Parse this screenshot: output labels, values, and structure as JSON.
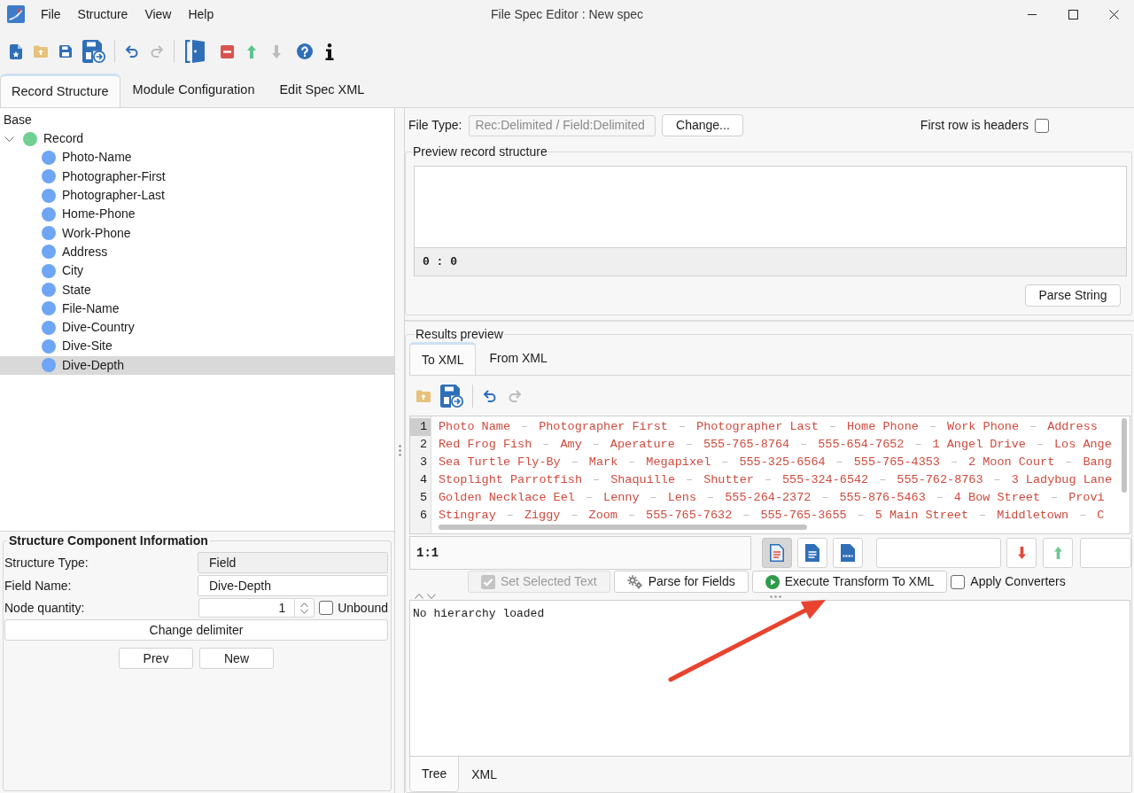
{
  "window": {
    "title": "File Spec Editor : New spec",
    "menu": [
      "File",
      "Structure",
      "View",
      "Help"
    ]
  },
  "toolbar": [
    {
      "divider": true,
      "items": [
        {
          "kind": "new",
          "disabled": false
        },
        {
          "kind": "open",
          "disabled": false
        },
        {
          "kind": "save",
          "disabled": false
        },
        {
          "kind": "save_as",
          "disabled": false
        }
      ]
    },
    {
      "divider": true,
      "items": [
        {
          "kind": "undo",
          "disabled": false
        },
        {
          "kind": "redo",
          "disabled": true
        }
      ]
    },
    {
      "divider": false,
      "items": [
        {
          "kind": "exit",
          "disabled": false
        }
      ]
    },
    {
      "divider": false,
      "items": [
        {
          "kind": "remove",
          "disabled": false
        },
        {
          "kind": "move_up",
          "disabled": false
        },
        {
          "kind": "move_down",
          "disabled": true
        }
      ]
    },
    {
      "divider": false,
      "items": [
        {
          "kind": "help",
          "disabled": false
        },
        {
          "kind": "info",
          "disabled": false
        }
      ]
    }
  ],
  "tabs": [
    {
      "label": "Record Structure",
      "selected": true
    },
    {
      "label": "Module Configuration",
      "selected": false
    },
    {
      "label": "Edit Spec XML",
      "selected": false
    }
  ],
  "tree": {
    "heading": "Base",
    "nodes": [
      {
        "label": "Record",
        "kind": "record",
        "expanded": true,
        "selected": false,
        "children": [
          {
            "label": "Photo-Name",
            "kind": "field",
            "selected": false
          },
          {
            "label": "Photographer-First",
            "kind": "field",
            "selected": false
          },
          {
            "label": "Photographer-Last",
            "kind": "field",
            "selected": false
          },
          {
            "label": "Home-Phone",
            "kind": "field",
            "selected": false
          },
          {
            "label": "Work-Phone",
            "kind": "field",
            "selected": false
          },
          {
            "label": "Address",
            "kind": "field",
            "selected": false
          },
          {
            "label": "City",
            "kind": "field",
            "selected": false
          },
          {
            "label": "State",
            "kind": "field",
            "selected": false
          },
          {
            "label": "File-Name",
            "kind": "field",
            "selected": false
          },
          {
            "label": "Dive-Country",
            "kind": "field",
            "selected": false
          },
          {
            "label": "Dive-Site",
            "kind": "field",
            "selected": false
          },
          {
            "label": "Dive-Depth",
            "kind": "field",
            "selected": true
          }
        ]
      }
    ]
  },
  "component_info": {
    "title": "Structure Component Information",
    "rows": [
      {
        "label": "Structure Type:",
        "kind": "readonly",
        "value": "Field"
      },
      {
        "label": "Field Name:",
        "kind": "text",
        "value": "Dive-Depth"
      },
      {
        "label": "Node quantity:",
        "kind": "spinner",
        "value": "1",
        "option": {
          "label": "Unbound",
          "checked": false
        }
      }
    ],
    "wide_button": "Change delimiter",
    "buttons": [
      "Prev",
      "New"
    ]
  },
  "file_type": {
    "label": "File Type:",
    "value": "Rec:Delimited / Field:Delimited",
    "disabled": true,
    "button": "Change...",
    "headers_option": {
      "label": "First row is headers",
      "checked": false
    }
  },
  "preview": {
    "title": "Preview record structure",
    "position": "0 : 0",
    "button": "Parse String"
  },
  "results": {
    "title": "Results preview",
    "tabs": [
      {
        "label": "To XML",
        "selected": true
      },
      {
        "label": "From XML",
        "selected": false
      }
    ],
    "toolbar": [
      {
        "divider": true,
        "items": [
          {
            "kind": "open",
            "disabled": false
          },
          {
            "kind": "save_as",
            "disabled": false
          }
        ]
      },
      {
        "divider": false,
        "items": [
          {
            "kind": "undo",
            "disabled": false
          },
          {
            "kind": "redo",
            "disabled": true
          }
        ]
      }
    ],
    "editor": {
      "separator": "–",
      "lines": [
        {
          "number": "1",
          "current": true,
          "fields": [
            "Photo Name",
            "Photographer First",
            "Photographer Last",
            "Home Phone",
            "Work Phone",
            "Address"
          ]
        },
        {
          "number": "2",
          "current": false,
          "fields": [
            "Red Frog Fish",
            "Amy",
            "Aperature",
            "555-765-8764",
            "555-654-7652",
            "1 Angel Drive",
            "Los Ange"
          ]
        },
        {
          "number": "3",
          "current": false,
          "fields": [
            "Sea Turtle Fly-By",
            "Mark",
            "Megapixel",
            "555-325-6564",
            "555-765-4353",
            "2 Moon Court",
            "Bang"
          ]
        },
        {
          "number": "4",
          "current": false,
          "fields": [
            "Stoplight Parrotfish",
            "Shaquille",
            "Shutter",
            "555-324-6542",
            "555-762-8763",
            "3 Ladybug Lane"
          ]
        },
        {
          "number": "5",
          "current": false,
          "fields": [
            "Golden Necklace Eel",
            "Lenny",
            "Lens",
            "555-264-2372",
            "555-876-5463",
            "4 Bow Street",
            "Provi"
          ]
        },
        {
          "number": "6",
          "current": false,
          "fields": [
            "Stingray",
            "Ziggy",
            "Zoom",
            "555-765-7632",
            "555-765-3655",
            "5 Main Street",
            "Middletown",
            "C"
          ]
        }
      ]
    },
    "cursor": "1:1",
    "view_buttons": [
      {
        "kind": "text",
        "selected": true
      },
      {
        "kind": "list",
        "selected": false
      },
      {
        "kind": "html",
        "selected": false
      }
    ],
    "actions": [
      {
        "label": "Set Selected Text",
        "kind": "check",
        "disabled": true
      },
      {
        "label": "Parse for Fields",
        "kind": "gears",
        "disabled": false
      },
      {
        "label": "Execute Transform To XML",
        "kind": "play",
        "disabled": false
      }
    ],
    "apply_converters": {
      "label": "Apply Converters",
      "checked": false
    },
    "output": "No hierarchy loaded",
    "bottom_tabs": [
      {
        "label": "Tree",
        "selected": true
      },
      {
        "label": "XML",
        "selected": false
      }
    ]
  }
}
